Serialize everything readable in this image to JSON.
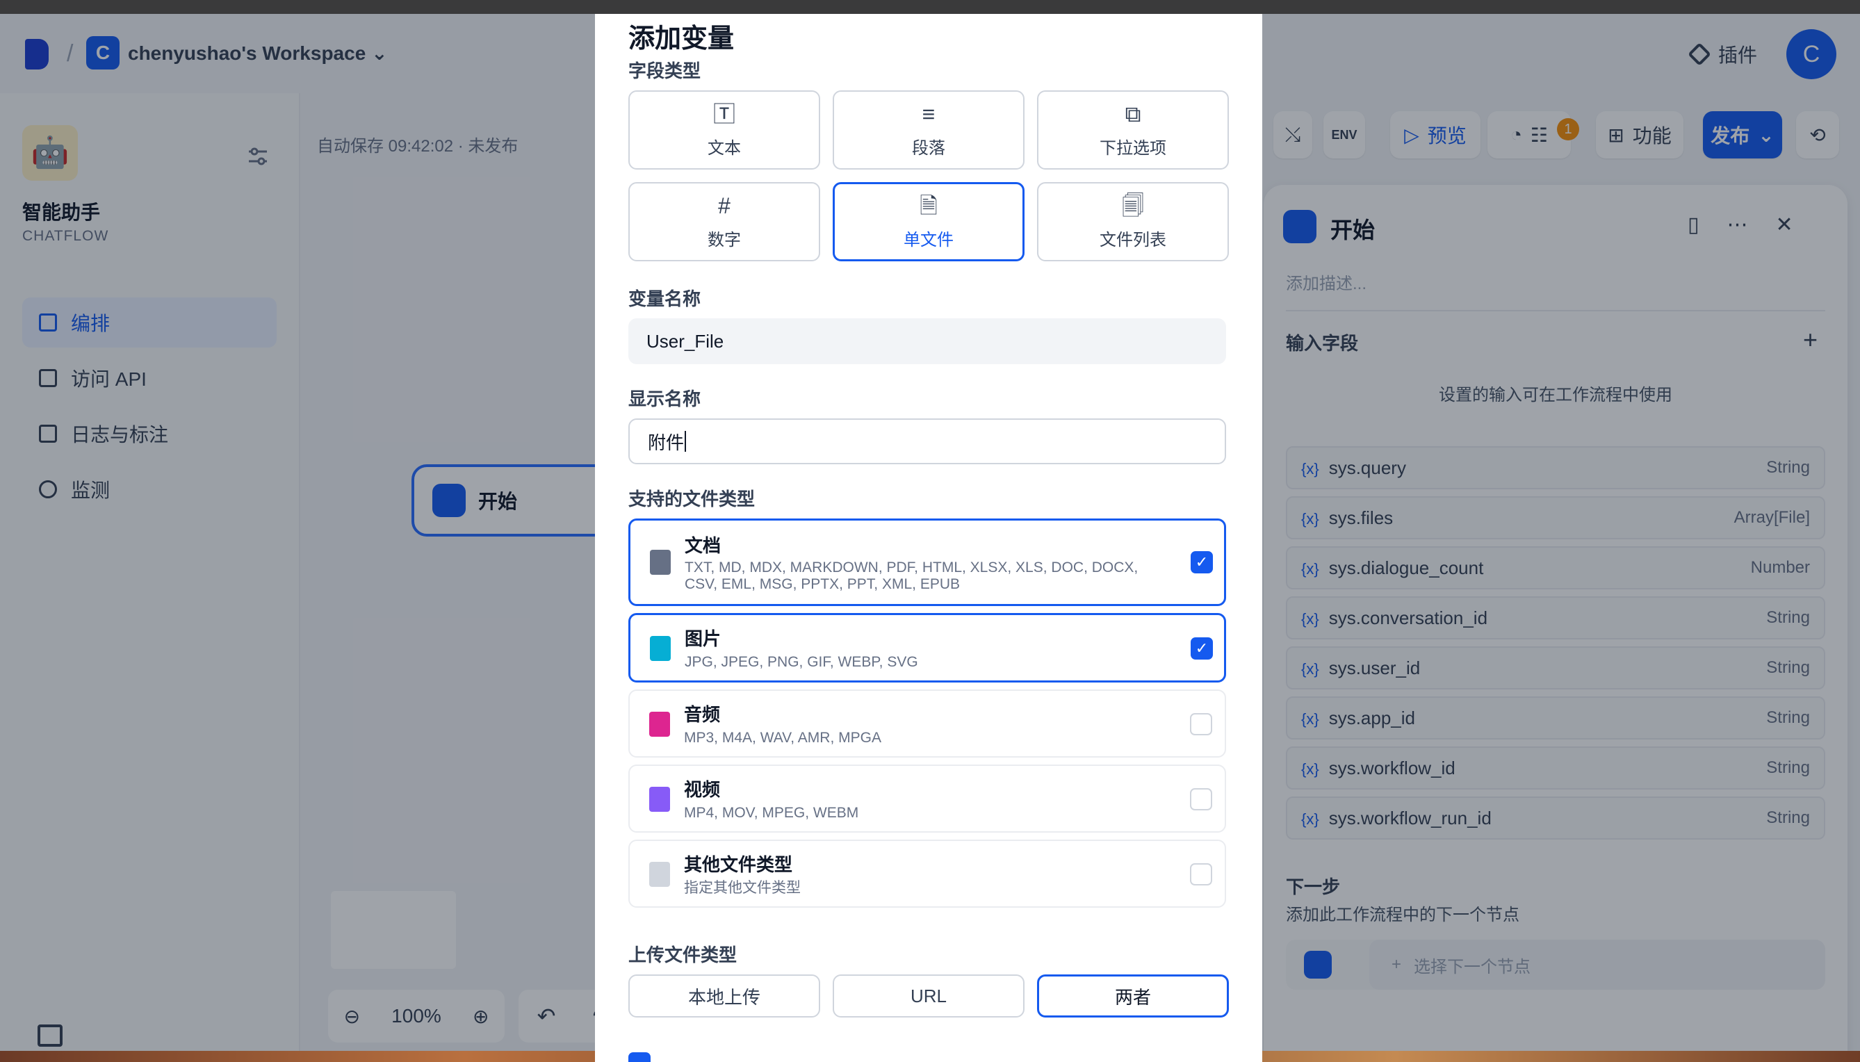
{
  "header": {
    "workspace_initial": "C",
    "workspace_name": "chenyushao's Workspace",
    "plugin_label": "插件",
    "user_initial": "C"
  },
  "sidebar": {
    "app_name": "智能助手",
    "app_type": "CHATFLOW",
    "items": [
      {
        "label": "编排",
        "active": true
      },
      {
        "label": "访问 API",
        "active": false
      },
      {
        "label": "日志与标注",
        "active": false
      },
      {
        "label": "监测",
        "active": false
      }
    ]
  },
  "canvas": {
    "autosave": "自动保存 09:42:02 · 未发布",
    "start_node_label": "开始",
    "zoom_level": "100%"
  },
  "toolbar": {
    "preview_label": "预览",
    "checklist_badge": "1",
    "features_label": "功能",
    "publish_label": "发布"
  },
  "right_panel": {
    "title": "开始",
    "description_placeholder": "添加描述...",
    "input_fields_title": "输入字段",
    "hint": "设置的输入可在工作流程中使用",
    "variables": [
      {
        "name": "sys.query",
        "type": "String"
      },
      {
        "name": "sys.files",
        "type": "Array[File]"
      },
      {
        "name": "sys.dialogue_count",
        "type": "Number"
      },
      {
        "name": "sys.conversation_id",
        "type": "String"
      },
      {
        "name": "sys.user_id",
        "type": "String"
      },
      {
        "name": "sys.app_id",
        "type": "String"
      },
      {
        "name": "sys.workflow_id",
        "type": "String"
      },
      {
        "name": "sys.workflow_run_id",
        "type": "String"
      }
    ],
    "next_title": "下一步",
    "next_hint": "添加此工作流程中的下一个节点",
    "next_select": "选择下一个节点"
  },
  "modal": {
    "title": "添加变量",
    "field_type_label": "字段类型",
    "field_types": [
      {
        "label": "文本",
        "icon": "text-icon",
        "glyph": "🅃"
      },
      {
        "label": "段落",
        "icon": "paragraph-icon",
        "glyph": "≡"
      },
      {
        "label": "下拉选项",
        "icon": "select-icon",
        "glyph": "⧉"
      },
      {
        "label": "数字",
        "icon": "hash-icon",
        "glyph": "#"
      },
      {
        "label": "单文件",
        "icon": "file-icon",
        "glyph": "🗎",
        "selected": true
      },
      {
        "label": "文件列表",
        "icon": "file-list-icon",
        "glyph": "🗐"
      }
    ],
    "var_name_label": "变量名称",
    "var_name_value": "User_File",
    "display_name_label": "显示名称",
    "display_name_value": "附件",
    "file_types_label": "支持的文件类型",
    "file_types": [
      {
        "name": "文档",
        "desc": "TXT, MD, MDX, MARKDOWN, PDF, HTML, XLSX, XLS, DOC, DOCX, CSV, EML, MSG, PPTX, PPT, XML, EPUB",
        "checked": true,
        "color": "#667085"
      },
      {
        "name": "图片",
        "desc": "JPG, JPEG, PNG, GIF, WEBP, SVG",
        "checked": true,
        "color": "#06aed4"
      },
      {
        "name": "音频",
        "desc": "MP3, M4A, WAV, AMR, MPGA",
        "checked": false,
        "color": "#dd2590"
      },
      {
        "name": "视频",
        "desc": "MP4, MOV, MPEG, WEBM",
        "checked": false,
        "color": "#875bf7"
      },
      {
        "name": "其他文件类型",
        "desc": "指定其他文件类型",
        "checked": false,
        "color": "#d0d5dd"
      }
    ],
    "upload_type_label": "上传文件类型",
    "upload_options": [
      {
        "label": "本地上传",
        "selected": false
      },
      {
        "label": "URL",
        "selected": false
      },
      {
        "label": "两者",
        "selected": true
      }
    ]
  }
}
